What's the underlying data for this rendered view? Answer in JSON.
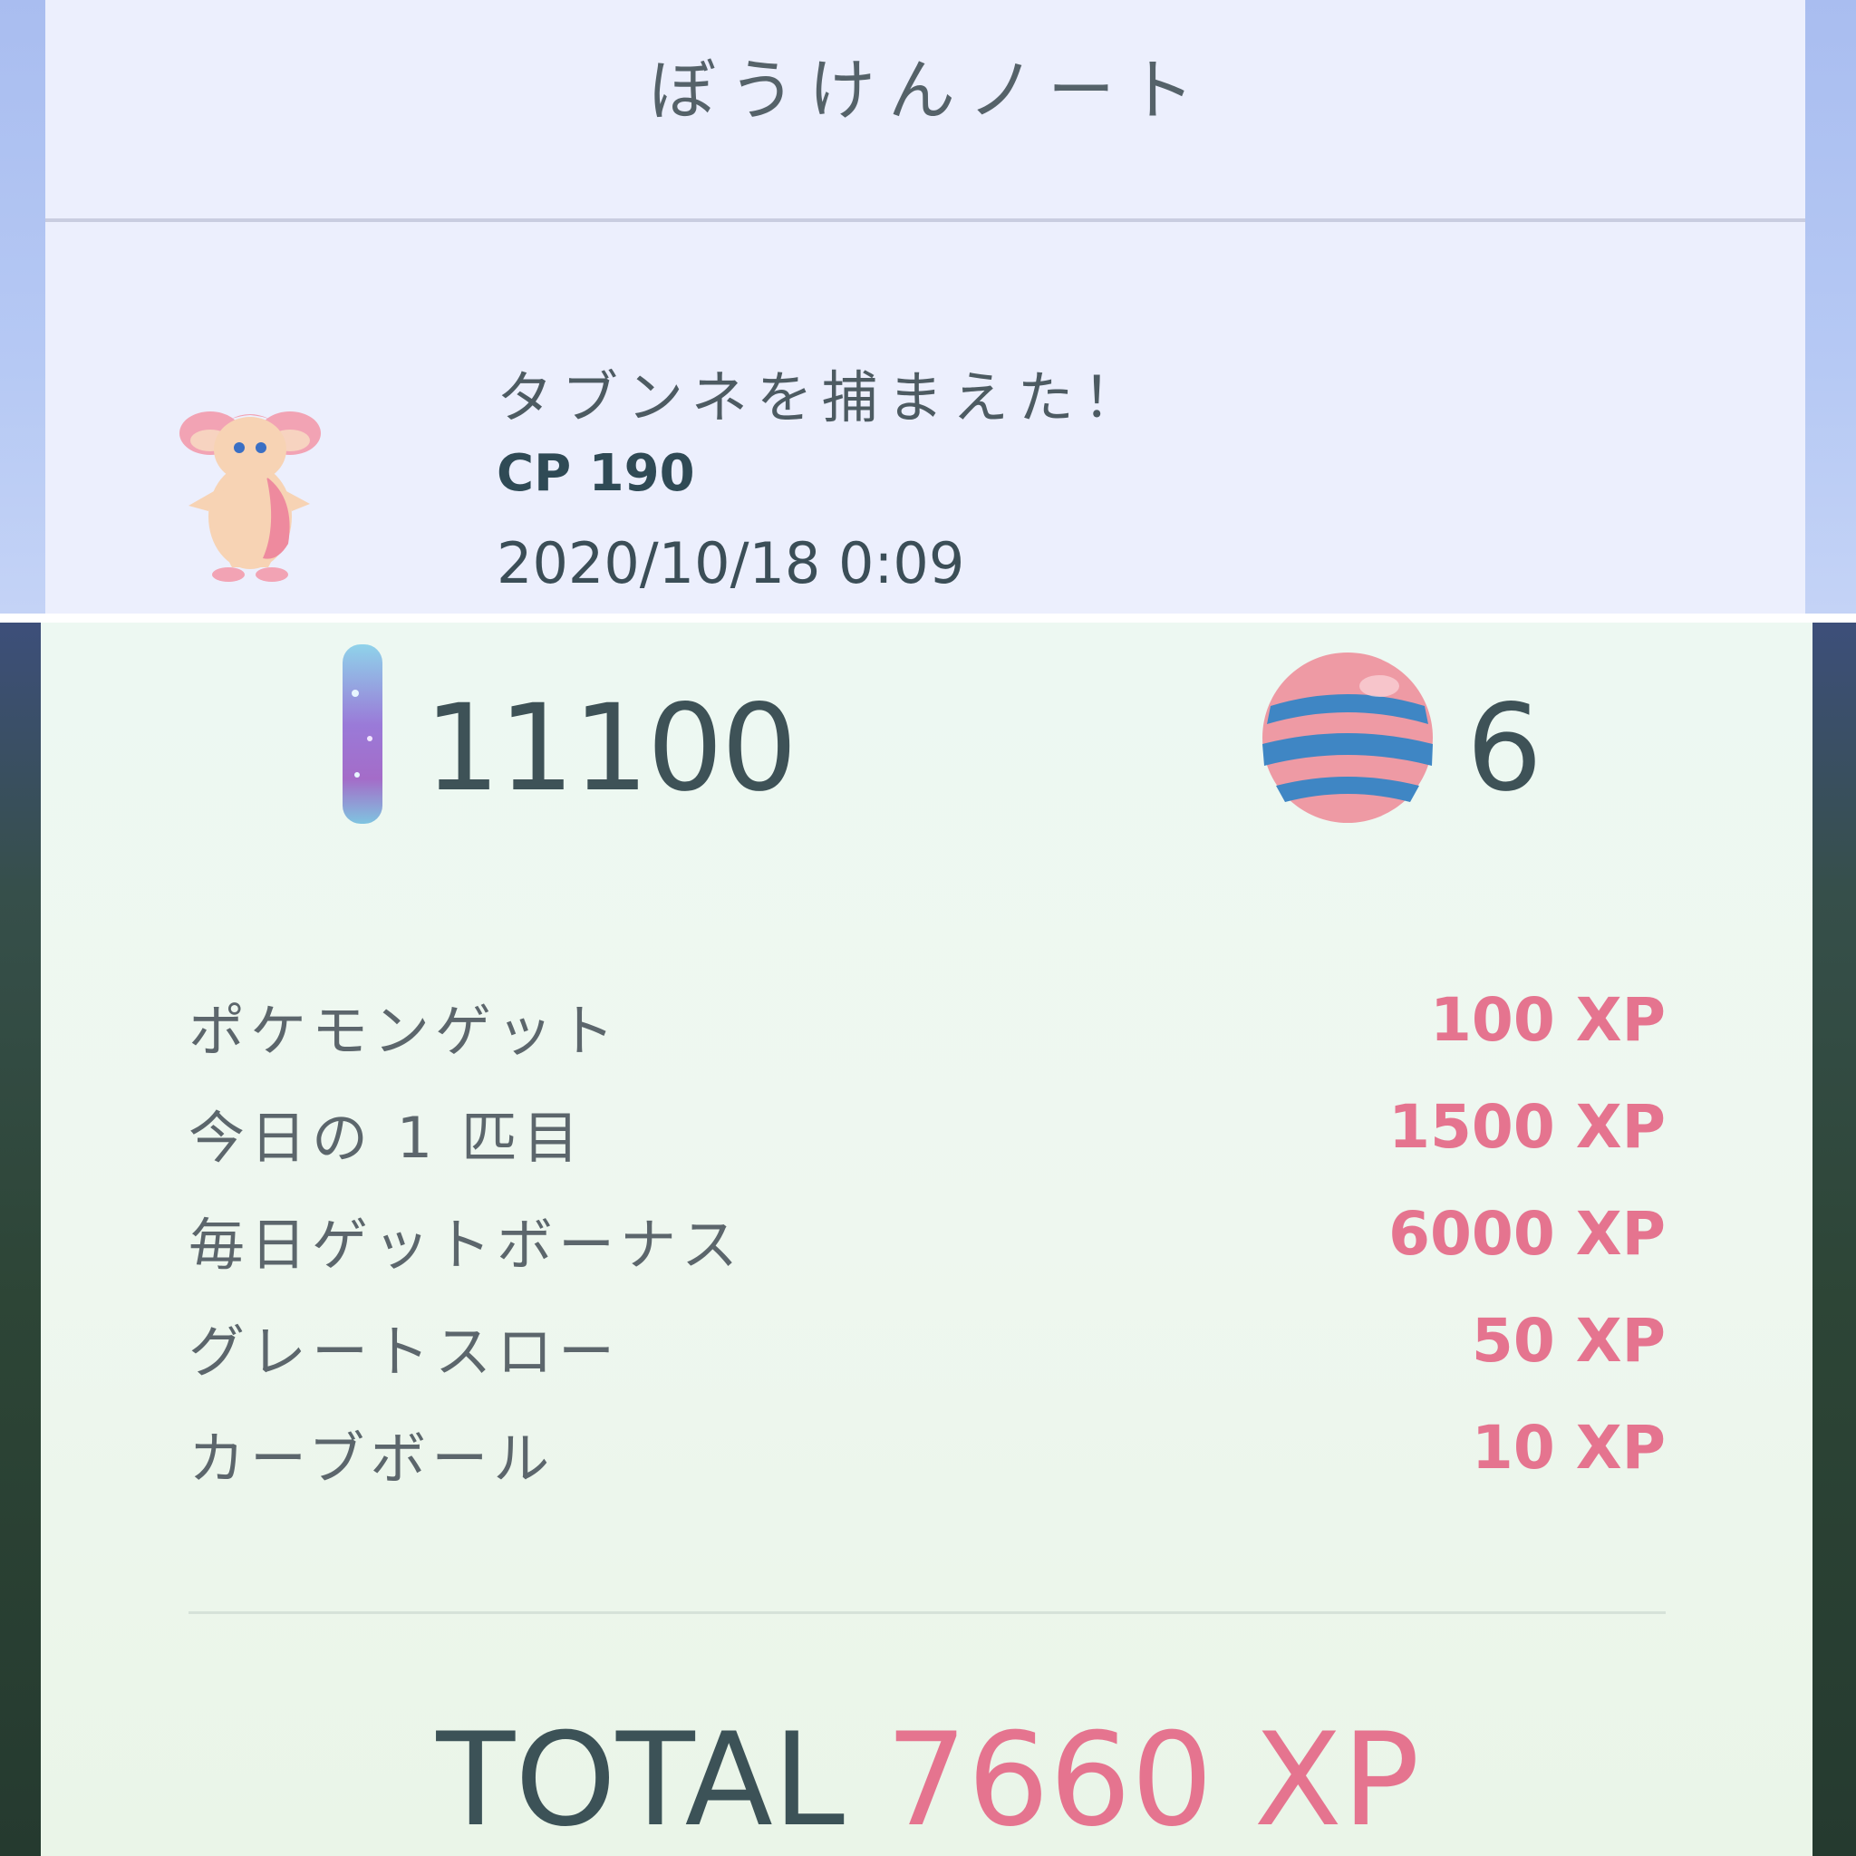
{
  "journal": {
    "title": "ぼうけんノート",
    "entry": {
      "pokemon_icon": "audino-sprite",
      "message": "タブンネを捕まえた！",
      "cp": "CP 190",
      "datetime": "2020/10/18 0:09"
    }
  },
  "rewards": {
    "stardust": {
      "icon": "stardust-icon",
      "value": "11100"
    },
    "candy": {
      "icon": "candy-icon",
      "value": "6"
    }
  },
  "xp_breakdown": [
    {
      "label": "ポケモンゲット",
      "value": "100 XP"
    },
    {
      "label": "今日の 1 匹目",
      "value": "1500 XP"
    },
    {
      "label": "毎日ゲットボーナス",
      "value": "6000 XP"
    },
    {
      "label": "グレートスロー",
      "value": "50 XP"
    },
    {
      "label": "カーブボール",
      "value": "10 XP"
    }
  ],
  "total": {
    "label": "TOTAL",
    "value": "7660 XP"
  },
  "colors": {
    "xp_pink": "#e5748f",
    "text_dark": "#3e5257",
    "top_card": "#eceffd",
    "bottom_card": "#edf8f2"
  }
}
